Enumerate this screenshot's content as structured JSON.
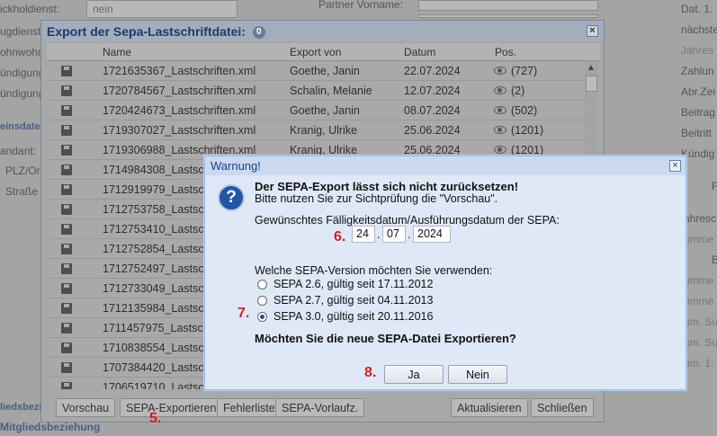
{
  "background": {
    "left_labels": [
      "ickholdienst:",
      "ugdienst",
      "ohnwohner",
      "ündigung",
      "ündigung",
      "einsdaten",
      "andant:",
      "PLZ/Or",
      "Straße",
      "liedsbezi",
      "Mitgliedsbeziehung"
    ],
    "top_field_value": "nein",
    "top_field2_label": "Partner Vorname:",
    "right_labels": [
      "Dat. 1.",
      "nächste",
      "Jahres",
      "Zahlun",
      "Abr.Zei",
      "Beitrag",
      "Beitritt",
      "Kündig",
      "F",
      "ahresc",
      "umme",
      "B",
      "umme",
      "umme",
      "um. Sum",
      "um. Sum",
      "um. 1."
    ]
  },
  "export_window": {
    "title": "Export der Sepa-Lastschriftdatei:",
    "badge": "0",
    "columns": [
      "Name",
      "Export von",
      "Datum",
      "Pos."
    ],
    "rows": [
      {
        "name": "1721635367_Lastschriften.xml",
        "by": "Goethe, Janin",
        "date": "22.07.2024",
        "pos": "(727)"
      },
      {
        "name": "1720784567_Lastschriften.xml",
        "by": "Schalin, Melanie",
        "date": "12.07.2024",
        "pos": "(2)"
      },
      {
        "name": "1720424673_Lastschriften.xml",
        "by": "Goethe, Janin",
        "date": "08.07.2024",
        "pos": "(502)"
      },
      {
        "name": "1719307027_Lastschriften.xml",
        "by": "Kranig, Ulrike",
        "date": "25.06.2024",
        "pos": "(1201)"
      },
      {
        "name": "1719306988_Lastschriften.xml",
        "by": "Kranig, Ulrike",
        "date": "25.06.2024",
        "pos": "(1201)"
      },
      {
        "name": "1714984308_Lastsc",
        "by": "",
        "date": "",
        "pos": ""
      },
      {
        "name": "1712919979_Lastsc",
        "by": "",
        "date": "",
        "pos": ""
      },
      {
        "name": "1712753758_Lastsc",
        "by": "",
        "date": "",
        "pos": ""
      },
      {
        "name": "1712753410_Lastsc",
        "by": "",
        "date": "",
        "pos": ""
      },
      {
        "name": "1712752854_Lastsc",
        "by": "",
        "date": "",
        "pos": ""
      },
      {
        "name": "1712752497_Lastsc",
        "by": "",
        "date": "",
        "pos": ""
      },
      {
        "name": "1712733049_Lastsc",
        "by": "",
        "date": "",
        "pos": ""
      },
      {
        "name": "1712135984_Lastsc",
        "by": "",
        "date": "",
        "pos": ""
      },
      {
        "name": "1711457975_Lastsc",
        "by": "",
        "date": "",
        "pos": ""
      },
      {
        "name": "1710838554_Lastsc",
        "by": "",
        "date": "",
        "pos": ""
      },
      {
        "name": "1707384420_Lastsc",
        "by": "",
        "date": "",
        "pos": ""
      },
      {
        "name": "1706519710_Lastsc",
        "by": "",
        "date": "",
        "pos": ""
      }
    ],
    "buttons": {
      "vorschau": "Vorschau",
      "sepa_export": "SEPA-Exportieren",
      "fehlerliste": "Fehlerliste",
      "vorlauf": "SEPA-Vorlaufz.",
      "aktualisieren": "Aktualisieren",
      "schliessen": "Schließen"
    }
  },
  "dialog": {
    "title": "Warnung!",
    "heading": "Der SEPA-Export lässt sich nicht zurücksetzen!",
    "hint": "Bitte nutzen Sie zur Sichtprüfung die \"Vorschau\".",
    "date_label": "Gewünschtes Fälligkeitsdatum/Ausführungsdatum der SEPA:",
    "date_day": "24",
    "date_month": "07",
    "date_year": "2024",
    "version_label": "Welche SEPA-Version möchten Sie verwenden:",
    "versions": [
      {
        "label": "SEPA 2.6, gültig seit 17.11.2012",
        "selected": false
      },
      {
        "label": "SEPA 2.7, gültig seit 04.11.2013",
        "selected": false
      },
      {
        "label": "SEPA 3.0, gültig seit 20.11.2016",
        "selected": true
      }
    ],
    "question": "Möchten Sie die neue SEPA-Datei Exportieren?",
    "yes": "Ja",
    "no": "Nein"
  },
  "steps": {
    "five": "5.",
    "six": "6.",
    "seven": "7.",
    "eight": "8."
  },
  "colors": {
    "step": "#d41f26",
    "dialog_title": "#15428b",
    "window_title": "#1d3b70"
  }
}
